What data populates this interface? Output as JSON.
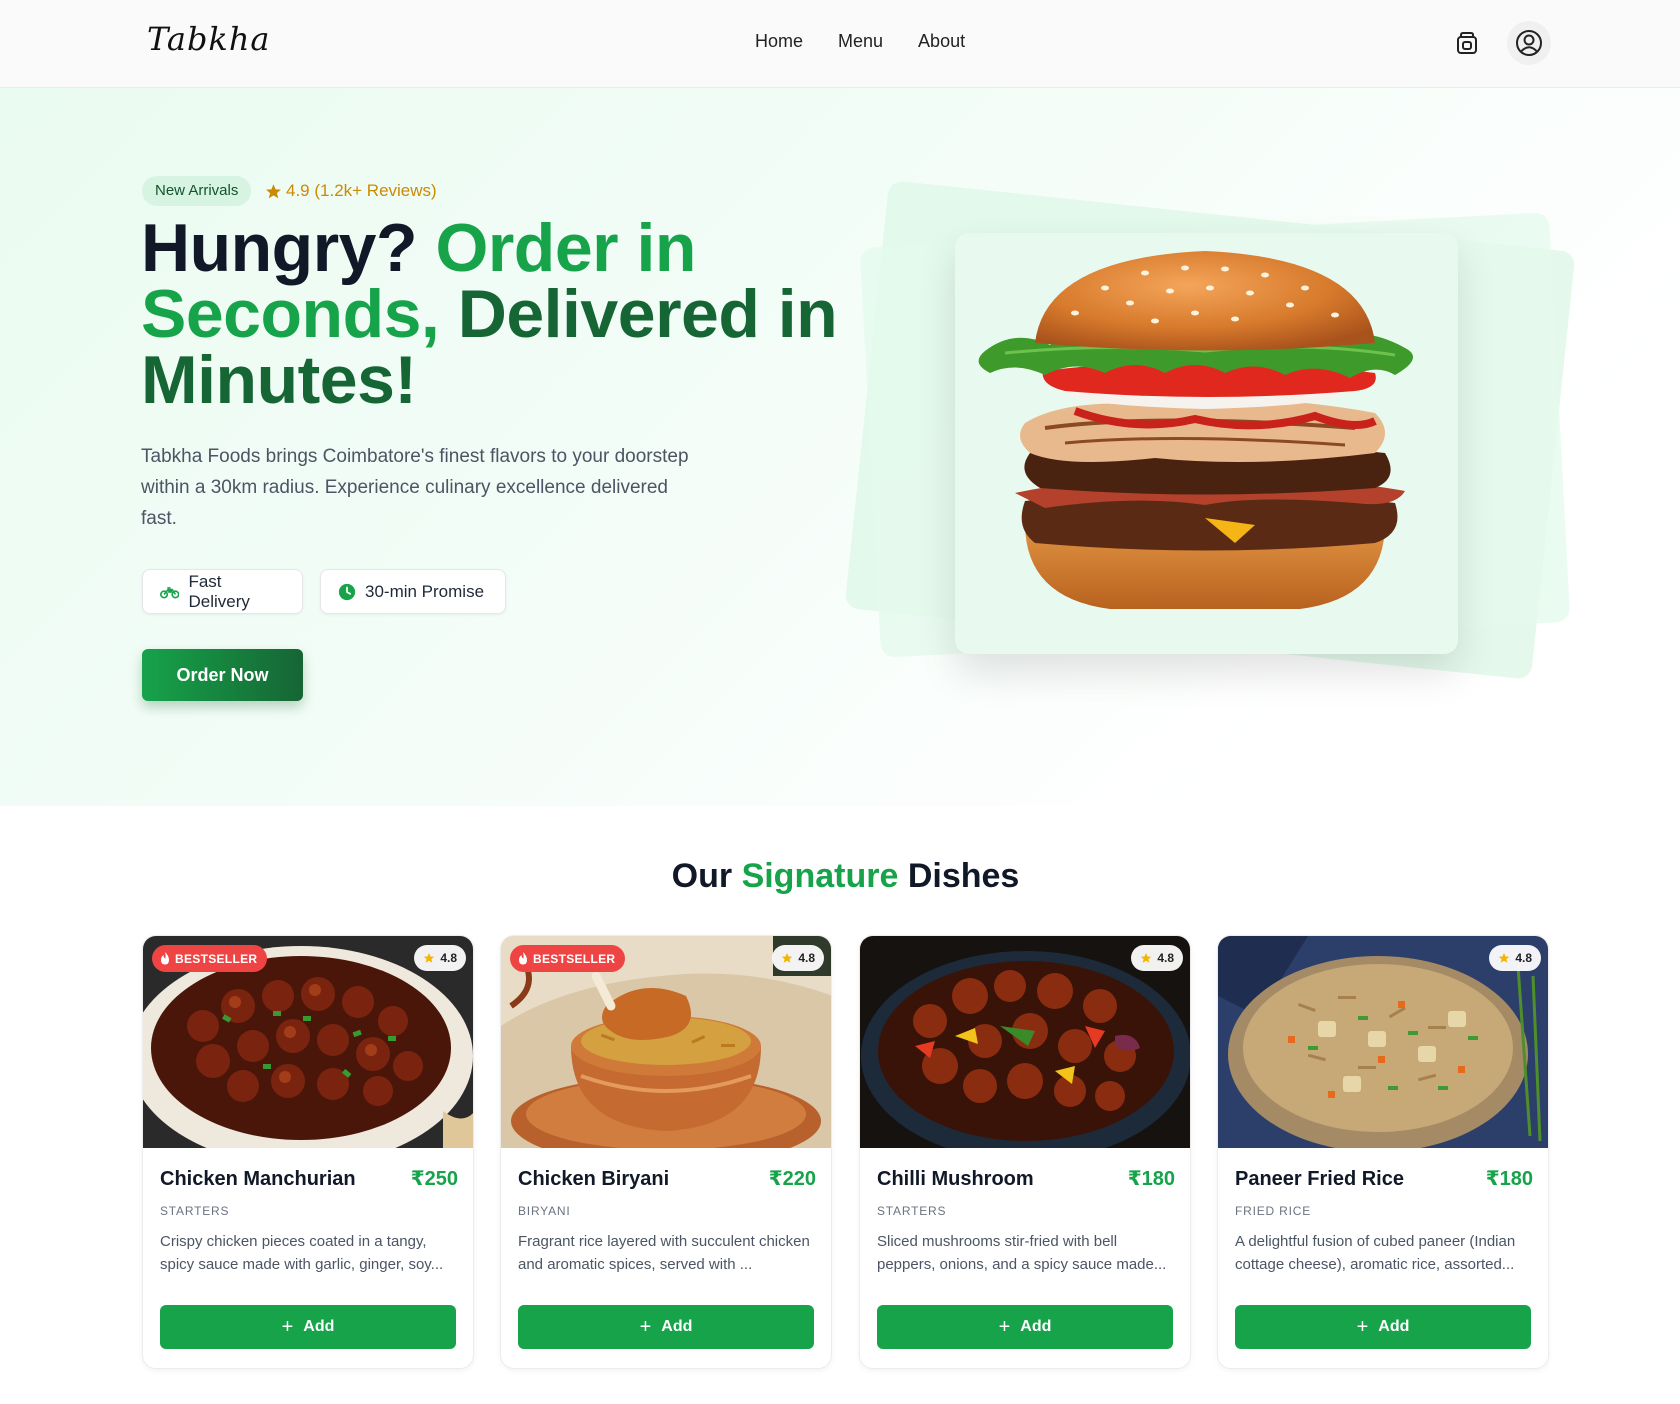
{
  "header": {
    "logo": "Tabkha",
    "nav": [
      "Home",
      "Menu",
      "About"
    ],
    "icons": [
      "shopping-bag-icon",
      "user-circle-icon"
    ]
  },
  "hero": {
    "badge": "New Arrivals",
    "rating": "4.9 (1.2k+ Reviews)",
    "headline": {
      "part1": "Hungry? ",
      "part2": "Order in Seconds,",
      "part3": " Delivered in Minutes!"
    },
    "description": "Tabkha Foods brings Coimbatore's finest flavors to your doorstep within a 30km radius. Experience culinary excellence delivered fast.",
    "features": [
      {
        "label": "Fast Delivery",
        "icon": "motorcycle-icon"
      },
      {
        "label": "30-min Promise",
        "icon": "clock-icon"
      }
    ],
    "cta": "Order Now",
    "image": "burger"
  },
  "section": {
    "title_pre": "Our ",
    "title_highlight": "Signature",
    "title_post": " Dishes"
  },
  "dishes": [
    {
      "name": "Chicken Manchurian",
      "price": "₹250",
      "category": "STARTERS",
      "description": "Crispy chicken pieces coated in a tangy, spicy sauce made with garlic, ginger, soy...",
      "badge": "BESTSELLER",
      "rating": "4.8",
      "add_label": "Add"
    },
    {
      "name": "Chicken Biryani",
      "price": "₹220",
      "category": "BIRYANI",
      "description": "Fragrant rice layered with succulent chicken and aromatic spices, served with ...",
      "badge": "BESTSELLER",
      "rating": "4.8",
      "add_label": "Add"
    },
    {
      "name": "Chilli Mushroom",
      "price": "₹180",
      "category": "STARTERS",
      "description": "Sliced mushrooms stir-fried with bell peppers, onions, and a spicy sauce made...",
      "rating": "4.8",
      "add_label": "Add"
    },
    {
      "name": "Paneer Fried Rice",
      "price": "₹180",
      "category": "FRIED RICE",
      "description": "A delightful fusion of cubed paneer (Indian cottage cheese), aromatic rice, assorted...",
      "rating": "4.8",
      "add_label": "Add"
    }
  ],
  "colors": {
    "primary": "#16a34a",
    "primary_dark": "#166534",
    "bestseller": "#ef4444",
    "star": "#f5b400",
    "text": "#111827"
  }
}
